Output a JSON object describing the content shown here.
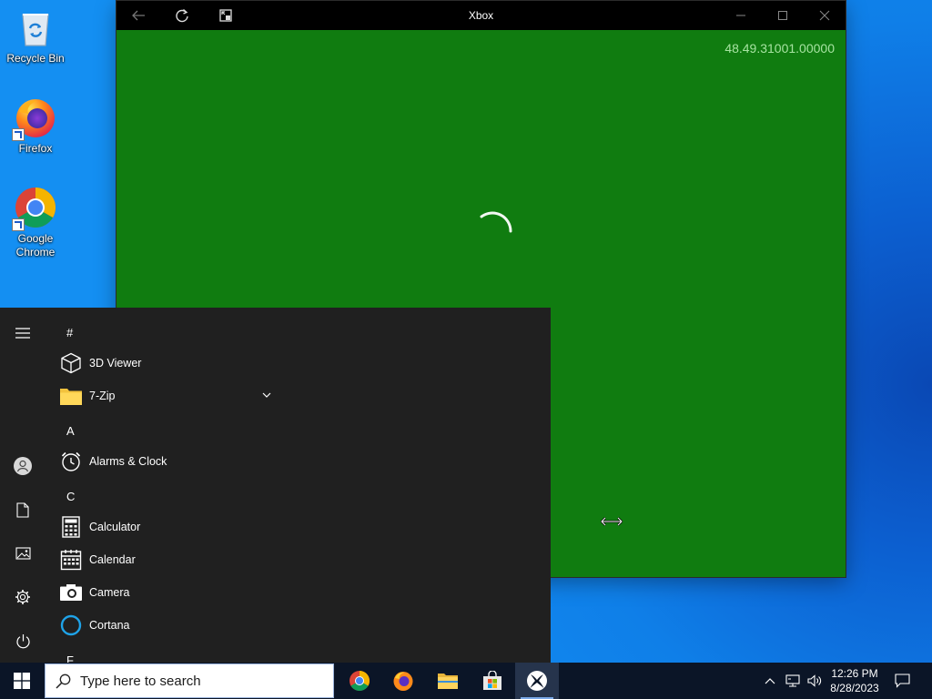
{
  "desktop": {
    "icons": [
      {
        "label": "Recycle Bin",
        "icon": "recycle-bin-icon"
      },
      {
        "label": "Firefox",
        "icon": "firefox-icon"
      },
      {
        "label": "Google Chrome",
        "icon": "chrome-icon"
      }
    ]
  },
  "xbox_window": {
    "title": "Xbox",
    "version": "48.49.31001.00000",
    "buttons": [
      "back-icon",
      "refresh-icon",
      "compact-overlay-icon",
      "minimize-icon",
      "maximize-icon",
      "close-icon"
    ],
    "background_color": "#107c10"
  },
  "start_menu": {
    "rail": [
      "hamburger-menu-icon",
      "user-icon",
      "documents-icon",
      "pictures-icon",
      "settings-icon",
      "power-icon"
    ],
    "sections": [
      {
        "letter": "#",
        "apps": [
          {
            "name": "3D Viewer",
            "icon": "cube-icon"
          },
          {
            "name": "7-Zip",
            "icon": "folder-icon",
            "expandable": true
          }
        ]
      },
      {
        "letter": "A",
        "apps": [
          {
            "name": "Alarms & Clock",
            "icon": "alarm-clock-icon"
          }
        ]
      },
      {
        "letter": "C",
        "apps": [
          {
            "name": "Calculator",
            "icon": "calculator-icon"
          },
          {
            "name": "Calendar",
            "icon": "calendar-icon"
          },
          {
            "name": "Camera",
            "icon": "camera-icon"
          },
          {
            "name": "Cortana",
            "icon": "cortana-icon"
          }
        ]
      },
      {
        "letter": "F",
        "apps": []
      }
    ]
  },
  "taskbar": {
    "search_placeholder": "Type here to search",
    "pinned": [
      "chrome-icon",
      "firefox-icon",
      "file-explorer-icon",
      "microsoft-store-icon",
      "xbox-icon"
    ],
    "active_app": "xbox-icon",
    "tray": [
      "show-hidden-icons-chevron",
      "network-icon",
      "volume-icon"
    ],
    "time": "12:26 PM",
    "date": "8/28/2023",
    "notification_icon": "notification-icon"
  }
}
